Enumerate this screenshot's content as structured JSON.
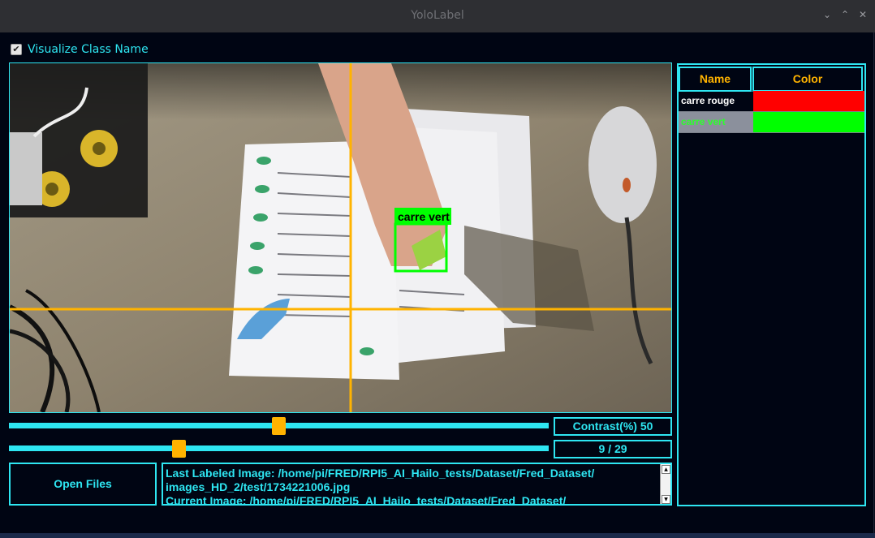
{
  "window": {
    "title": "YoloLabel",
    "controls": [
      "⌄",
      "⌃",
      "✕"
    ]
  },
  "visualize": {
    "label": "Visualize Class Name",
    "checked": true
  },
  "canvas": {
    "box_label": "carre vert",
    "colors": {
      "crosshair": "#ffb300",
      "box": "#00ff00"
    }
  },
  "class_table": {
    "headers": {
      "name": "Name",
      "color": "Color"
    },
    "rows": [
      {
        "name": "carre rouge",
        "color": "#ff0000",
        "text_color": "#ffffff",
        "selected": false
      },
      {
        "name": "carre vert",
        "color": "#00ff00",
        "text_color": "#2cff2c",
        "selected": true
      }
    ]
  },
  "contrast": {
    "label": "Contrast(%) 50",
    "value_percent": 50
  },
  "image_index": {
    "label": "9 / 29",
    "current": 9,
    "total": 29
  },
  "open_files": {
    "label": "Open Files"
  },
  "info": {
    "lines": [
      "Last Labeled Image: /home/pi/FRED/RPI5_AI_Hailo_tests/Dataset/Fred_Dataset/",
      "images_HD_2/test/1734221006.jpg",
      "Current Image: /home/pi/FRED/RPI5_AI_Hailo_tests/Dataset/Fred_Dataset/"
    ]
  },
  "colors": {
    "accent": "#2ee6f2",
    "highlight": "#ffb300",
    "background": "#000513"
  }
}
